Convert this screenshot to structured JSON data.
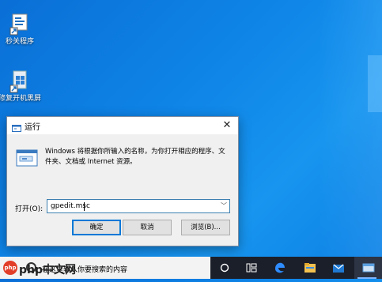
{
  "desktop": {
    "icons": [
      {
        "label": "秒关程序",
        "icon": "shortcut-app-icon"
      },
      {
        "label": "修复开机黑屏",
        "icon": "repair-tool-icon"
      }
    ]
  },
  "dialog": {
    "title": "运行",
    "description": "Windows 将根据你所输入的名称，为你打开相应的程序、文件夹、文档或 Internet 资源。",
    "open_label": "打开(O):",
    "input_value": "gpedit.msc",
    "buttons": {
      "ok": "确定",
      "cancel": "取消",
      "browse": "浏览(B)..."
    }
  },
  "taskbar": {
    "search_placeholder": "在这里输入你要搜索的内容",
    "watermark": "php中文网",
    "items": [
      "task-view-icon",
      "task-manager-icon",
      "edge-icon",
      "explorer-icon",
      "store-icon",
      "run-app-icon"
    ]
  },
  "colors": {
    "accent": "#0078d7",
    "desktop": "#0f86e8",
    "taskbar": "#1b1f2a"
  }
}
